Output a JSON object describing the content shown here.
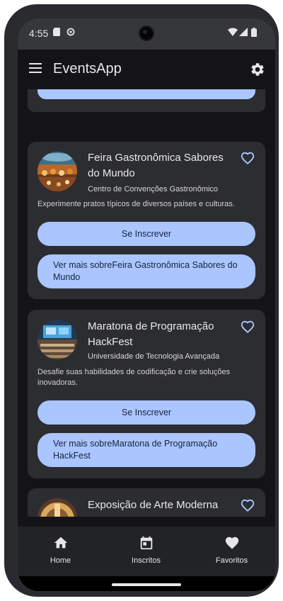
{
  "status_bar": {
    "time": "4:55",
    "icons": [
      "sim-card-icon",
      "sync-icon",
      "wifi-icon",
      "signal-icon",
      "battery-icon"
    ]
  },
  "app_bar": {
    "title": "EventsApp",
    "menu_icon": "menu-icon",
    "settings_icon": "gear-icon"
  },
  "events": [
    {
      "title": "Feira Gastronômica Sabores do Mundo",
      "location": "Centro de Convenções Gastronômico",
      "description": "Experimente pratos típicos de diversos países e culturas.",
      "subscribe_label": "Se Inscrever",
      "more_label": "Ver mais sobreFeira Gastronômica Sabores do Mundo",
      "favorite_icon": "heart-outline-icon"
    },
    {
      "title": "Maratona de Programação HackFest",
      "location": "Universidade de Tecnologia Avançada",
      "description": "Desafie suas habilidades de codificação e crie soluções inovadoras.",
      "subscribe_label": "Se Inscrever",
      "more_label": "Ver mais sobreMaratona de Programação HackFest",
      "favorite_icon": "heart-outline-icon"
    },
    {
      "title": "Exposição de Arte Moderna",
      "favorite_icon": "heart-outline-icon"
    }
  ],
  "bottom_nav": [
    {
      "label": "Home",
      "icon": "home-icon"
    },
    {
      "label": "Inscritos",
      "icon": "calendar-icon"
    },
    {
      "label": "Favoritos",
      "icon": "heart-icon"
    }
  ],
  "colors": {
    "background": "#141418",
    "card": "#2c2d31",
    "button": "#abc6ff",
    "button_text": "#14243f",
    "text": "#e9e9ec"
  }
}
